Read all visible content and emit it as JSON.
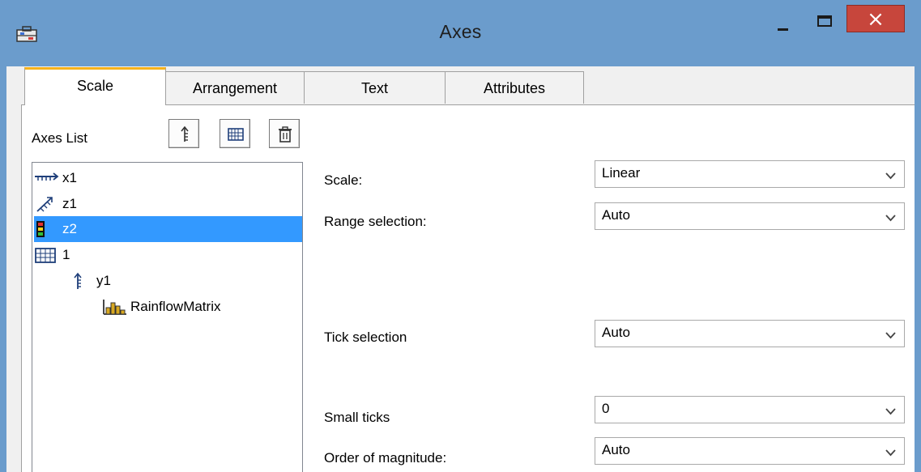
{
  "window": {
    "title": "Axes",
    "close_glyph": "×"
  },
  "tabs": [
    {
      "label": "Scale",
      "active": true
    },
    {
      "label": "Arrangement",
      "active": false
    },
    {
      "label": "Text",
      "active": false
    },
    {
      "label": "Attributes",
      "active": false
    }
  ],
  "axes_list": {
    "label": "Axes List",
    "toolbar": [
      {
        "icon": "y-axis-icon"
      },
      {
        "icon": "grid-icon"
      },
      {
        "icon": "trash-icon"
      }
    ],
    "items": [
      {
        "label": "x1",
        "icon": "x-axis-icon"
      },
      {
        "label": "z1",
        "icon": "z-axis-icon"
      },
      {
        "label": "z2",
        "icon": "color-scale-icon",
        "selected": true
      },
      {
        "label": "1",
        "icon": "grid-icon"
      },
      {
        "label": "y1",
        "icon": "y-axis-icon"
      },
      {
        "label": "RainflowMatrix",
        "icon": "histogram-icon"
      }
    ]
  },
  "fields": {
    "scale": {
      "label": "Scale:",
      "value": "Linear"
    },
    "range_selection": {
      "label": "Range selection:",
      "value": "Auto"
    },
    "tick_selection": {
      "label": "Tick selection",
      "value": "Auto"
    },
    "small_ticks": {
      "label": "Small ticks",
      "value": "0"
    },
    "order_of_magnitude": {
      "label": "Order of magnitude:",
      "value": "Auto"
    }
  },
  "colors": {
    "titlebar": "#6b9ccc",
    "close_button": "#c7463c",
    "selection": "#3399ff",
    "active_tab_accent": "#f6b21b"
  }
}
